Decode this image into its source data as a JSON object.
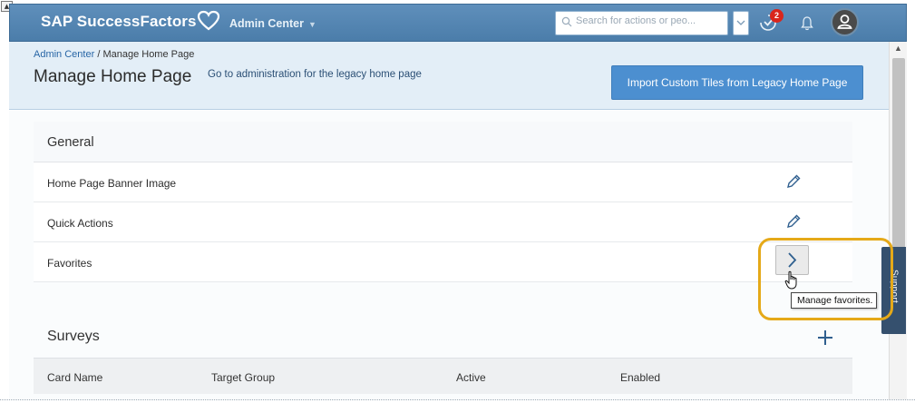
{
  "shell": {
    "brand": "SAP SuccessFactors",
    "admin_menu": "Admin Center",
    "search_placeholder": "Search for actions or peo...",
    "notification_count": "2"
  },
  "header": {
    "breadcrumb_link": "Admin Center",
    "breadcrumb_separator": " / ",
    "breadcrumb_current": "Manage Home Page",
    "title": "Manage Home Page",
    "legacy_link": "Go to administration for the legacy home page",
    "import_button": "Import Custom Tiles from Legacy Home Page"
  },
  "general": {
    "title": "General",
    "rows": [
      {
        "label": "Home Page Banner Image",
        "action": "edit"
      },
      {
        "label": "Quick Actions",
        "action": "edit"
      },
      {
        "label": "Favorites",
        "action": "navigate"
      }
    ]
  },
  "tooltip": "Manage favorites.",
  "support_tab": "Support",
  "surveys": {
    "title": "Surveys",
    "columns": [
      "Card Name",
      "Target Group",
      "Active",
      "Enabled"
    ]
  },
  "colors": {
    "shell_bar": "#4b7daa",
    "header_bg": "#e3eef7",
    "primary_button": "#4c8fd0",
    "highlight": "#e5a918",
    "badge": "#d9261c",
    "support_tab": "#35506e"
  },
  "icons": {
    "brand": "heart-icon",
    "search": "search-icon",
    "todo": "todo-check-icon",
    "notifications": "bell-icon",
    "avatar": "user-avatar-icon",
    "edit": "pencil-icon",
    "navigate": "chevron-right-icon",
    "add": "plus-icon",
    "pointer": "hand-cursor-icon"
  }
}
